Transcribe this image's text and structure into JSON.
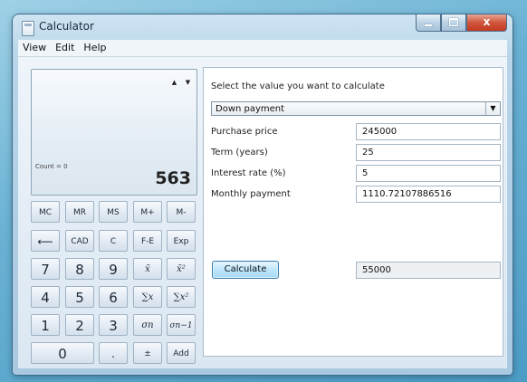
{
  "window": {
    "title": "Calculator",
    "close_glyph": "x"
  },
  "menu": [
    "View",
    "Edit",
    "Help"
  ],
  "display": {
    "up_arrow": "▲",
    "down_arrow": "▼",
    "count": "Count = 0",
    "value": "563"
  },
  "keys": {
    "mc": "MC",
    "mr": "MR",
    "ms": "MS",
    "mplus": "M+",
    "mminus": "M-",
    "back": "⟵",
    "cad": "CAD",
    "c": "C",
    "fe": "F-E",
    "exp": "Exp",
    "n7": "7",
    "n8": "8",
    "n9": "9",
    "mean": "x̄",
    "mean_sq": "x̄²",
    "n4": "4",
    "n5": "5",
    "n6": "6",
    "sum": "∑x",
    "sum_sq": "∑x²",
    "n1": "1",
    "n2": "2",
    "n3": "3",
    "sigma_n": "σn",
    "sigma_n1": "σn−1",
    "n0": "0",
    "dot": ".",
    "pm": "±",
    "add": "Add"
  },
  "panel": {
    "prompt": "Select the value you want to calculate",
    "selected": "Down payment",
    "dropdown_icon": "▼",
    "rows": [
      {
        "label": "Purchase price",
        "value": "245000"
      },
      {
        "label": "Term (years)",
        "value": "25"
      },
      {
        "label": "Interest rate (%)",
        "value": "5"
      },
      {
        "label": "Monthly payment",
        "value": "1110.72107886516"
      }
    ],
    "calculate_label": "Calculate",
    "result": "55000"
  }
}
